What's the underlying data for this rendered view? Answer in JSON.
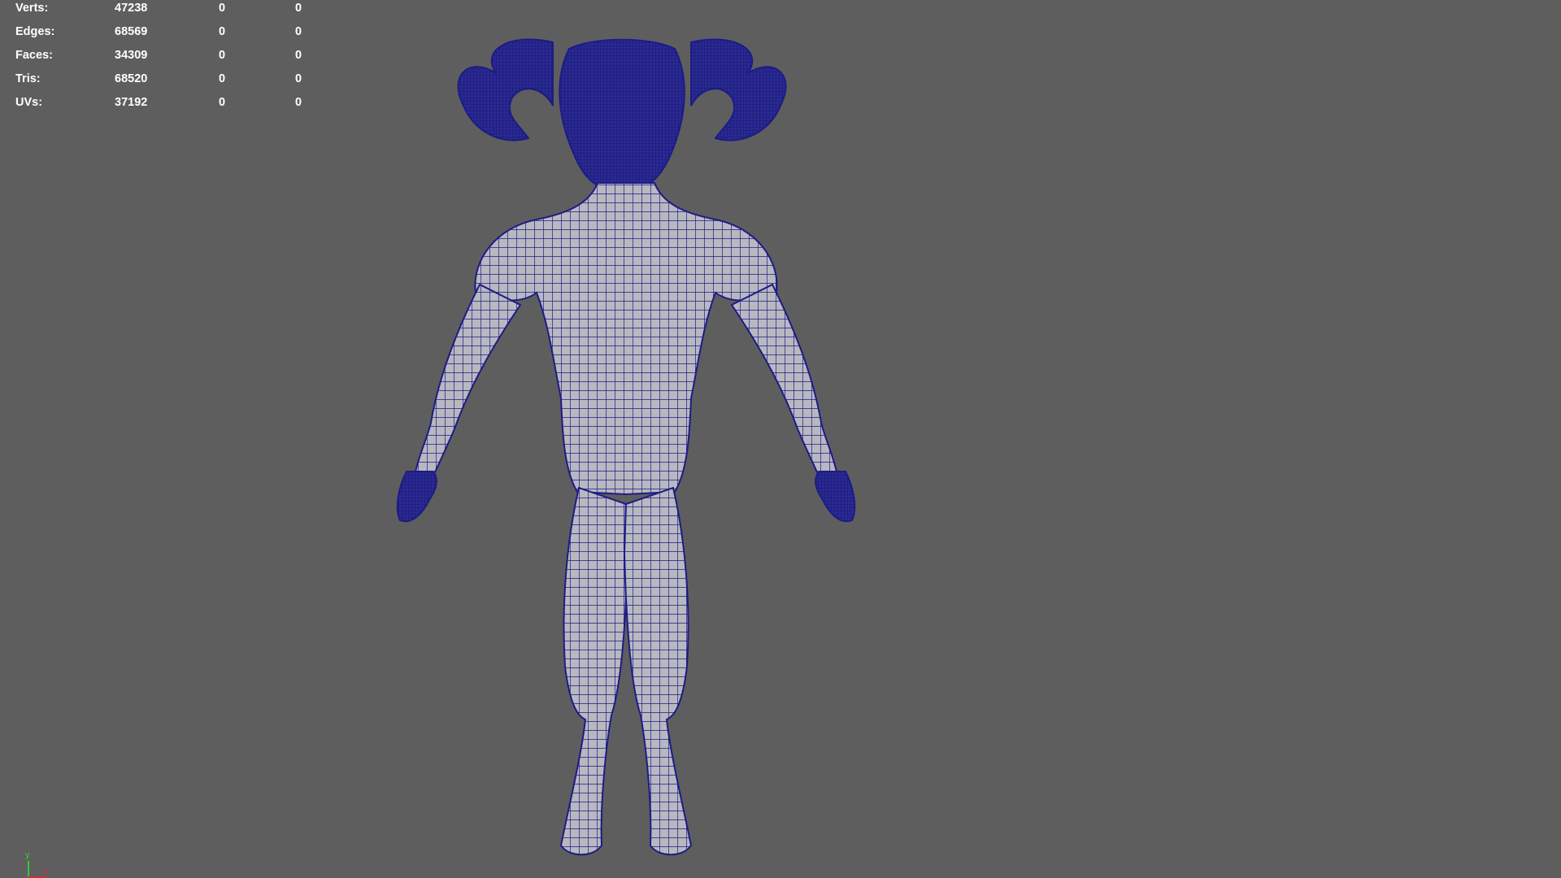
{
  "poly_count": {
    "rows": [
      {
        "label": "Verts:",
        "count": "47238",
        "selected": "0",
        "selected_uv": "0"
      },
      {
        "label": "Edges:",
        "count": "68569",
        "selected": "0",
        "selected_uv": "0"
      },
      {
        "label": "Faces:",
        "count": "34309",
        "selected": "0",
        "selected_uv": "0"
      },
      {
        "label": "Tris:",
        "count": "68520",
        "selected": "0",
        "selected_uv": "0"
      },
      {
        "label": "UVs:",
        "count": "37192",
        "selected": "0",
        "selected_uv": "0"
      }
    ]
  },
  "axis_indicator": {
    "y_label": "y",
    "x_label": "x"
  },
  "colors": {
    "viewport_bg": "#5e5e5e",
    "wireframe": "#1c1c86",
    "mesh_fill": "#b8b8c0",
    "axis_y": "#38c838",
    "axis_x": "#d03030"
  },
  "model": {
    "description_icon": "demon-wireframe-model"
  }
}
